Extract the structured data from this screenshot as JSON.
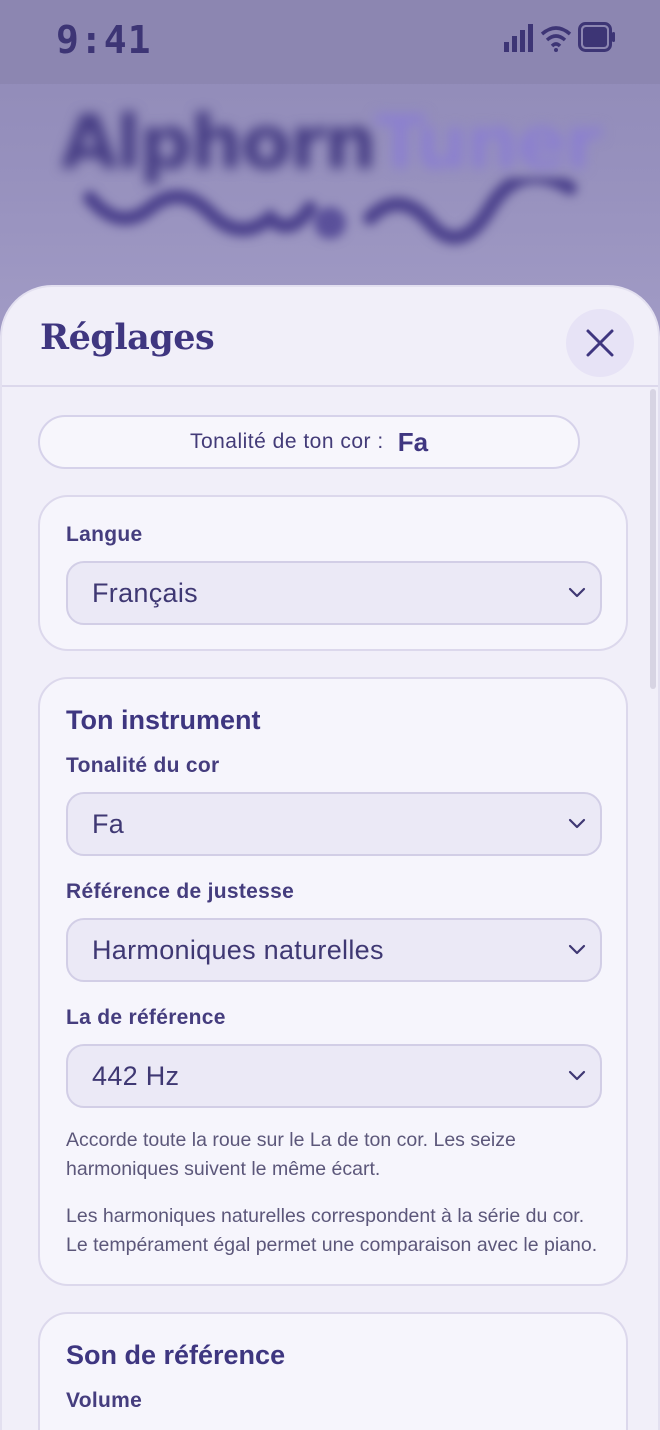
{
  "status_bar": {
    "time": "9:41"
  },
  "background": {
    "logo_part1": "Alphorn",
    "logo_part2": "Tuner"
  },
  "sheet": {
    "title": "Réglages"
  },
  "key_summary": {
    "label": "Tonalité de ton cor :",
    "value": "Fa"
  },
  "language_card": {
    "label": "Langue",
    "selected": "Français"
  },
  "instrument_card": {
    "title": "Ton instrument",
    "key_label": "Tonalité du cor",
    "key_selected": "Fa",
    "tuning_label": "Référence de justesse",
    "tuning_selected": "Harmoniques naturelles",
    "a_ref_label": "La de référence",
    "a_ref_selected": "442 Hz",
    "help1": "Accorde toute la roue sur le La de ton cor. Les seize harmoniques suivent le même écart.",
    "help2": "Les harmoniques naturelles correspondent à la série du cor. Le tempérament égal permet une comparaison avec le piano."
  },
  "sound_card": {
    "title": "Son de référence",
    "volume_label": "Volume"
  },
  "icons": {
    "close": "close-icon",
    "chevron": "chevron-down-icon",
    "signal": "signal-icon",
    "wifi": "wifi-icon",
    "battery": "battery-icon"
  },
  "colors": {
    "accent": "#3f3680",
    "sheet_bg": "#f1eff9",
    "overlay": "#8e88b4"
  }
}
